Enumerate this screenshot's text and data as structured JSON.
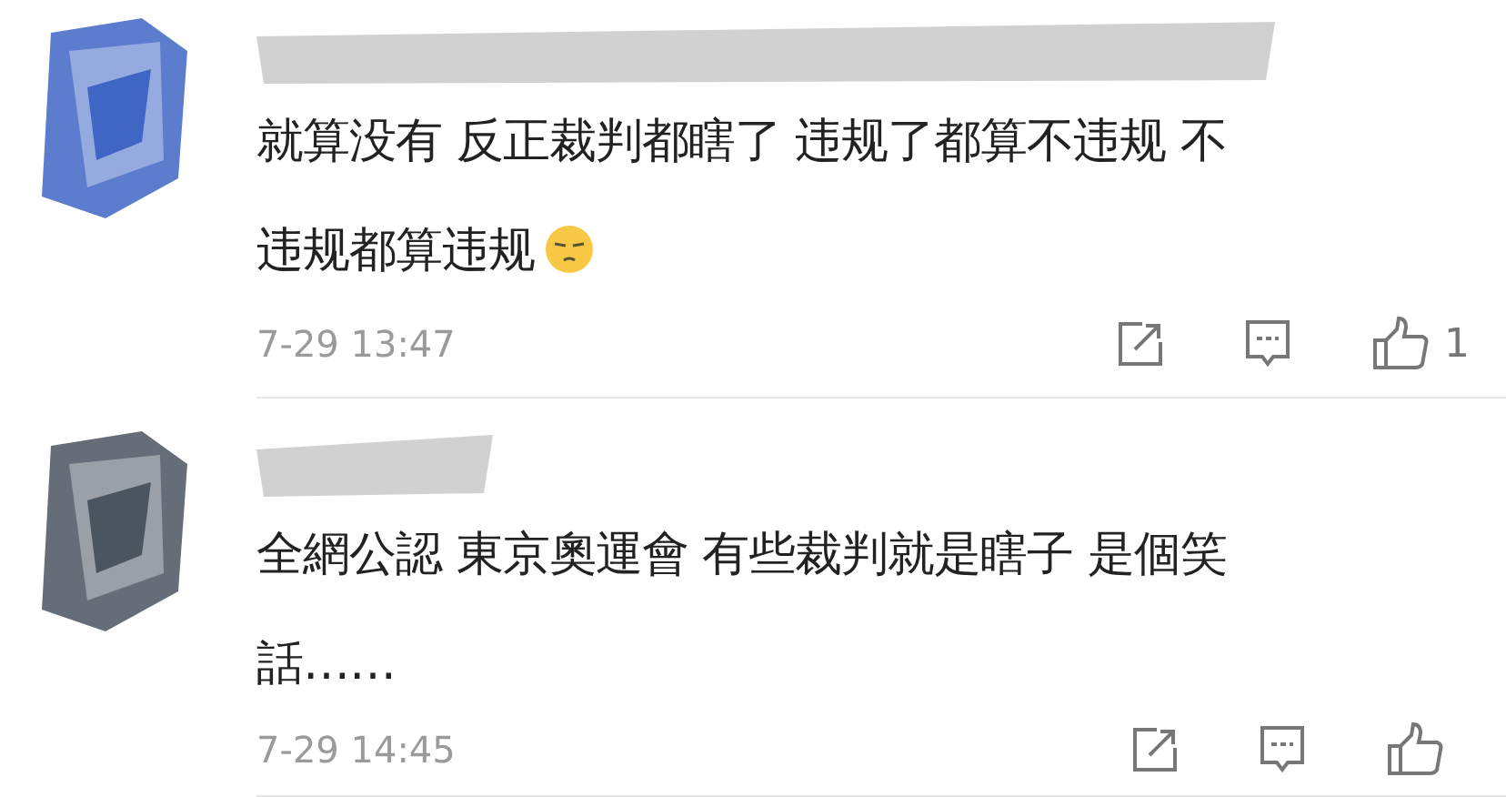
{
  "comments": [
    {
      "lines": [
        "就算没有 反正裁判都瞎了 违规了都算不违规 不",
        "违规都算违规"
      ],
      "emoji": true,
      "time": "7-29 13:47",
      "likes": "1"
    },
    {
      "lines": [
        "全網公認 東京奧運會 有些裁判就是瞎子 是個笑",
        "話……"
      ],
      "emoji": false,
      "time": "7-29 14:45"
    }
  ]
}
